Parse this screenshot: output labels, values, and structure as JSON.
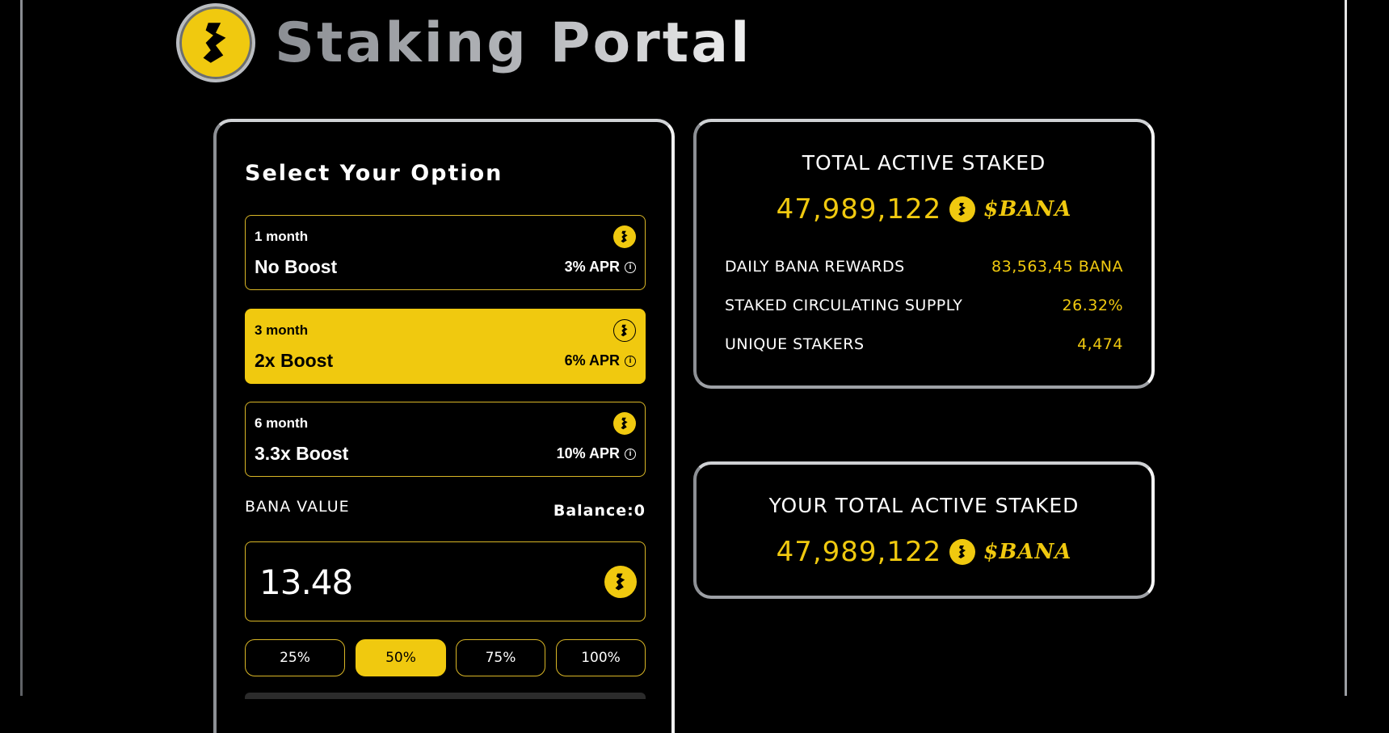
{
  "header": {
    "title": "Staking Portal",
    "logo_icon": "bana-logo-icon"
  },
  "colors": {
    "accent": "#f0c90f",
    "background": "#000000",
    "border": "#d9b626"
  },
  "stake_form": {
    "title": "Select Your Option",
    "options": [
      {
        "duration": "1 month",
        "boost": "No Boost",
        "apr": "3% APR",
        "selected": false
      },
      {
        "duration": "3 month",
        "boost": "2x Boost",
        "apr": "6% APR",
        "selected": true
      },
      {
        "duration": "6 month",
        "boost": "3.3x Boost",
        "apr": "10% APR",
        "selected": false
      }
    ],
    "value_label": "BANA VALUE",
    "balance": "Balance:0",
    "value": "13.48",
    "percent_buttons": [
      "25%",
      "50%",
      "75%",
      "100%"
    ],
    "active_percent": "50%"
  },
  "total_staked": {
    "title": "TOTAL ACTIVE STAKED",
    "amount": "47,989,122",
    "ticker": "$BANA",
    "stats": [
      {
        "label": "DAILY BANA REWARDS",
        "value": "83,563,45 BANA"
      },
      {
        "label": "STAKED CIRCULATING SUPPLY",
        "value": "26.32%"
      },
      {
        "label": "UNIQUE STAKERS",
        "value": "4,474"
      }
    ]
  },
  "your_staked": {
    "title": "YOUR TOTAL ACTIVE STAKED",
    "amount": "47,989,122",
    "ticker": "$BANA"
  }
}
